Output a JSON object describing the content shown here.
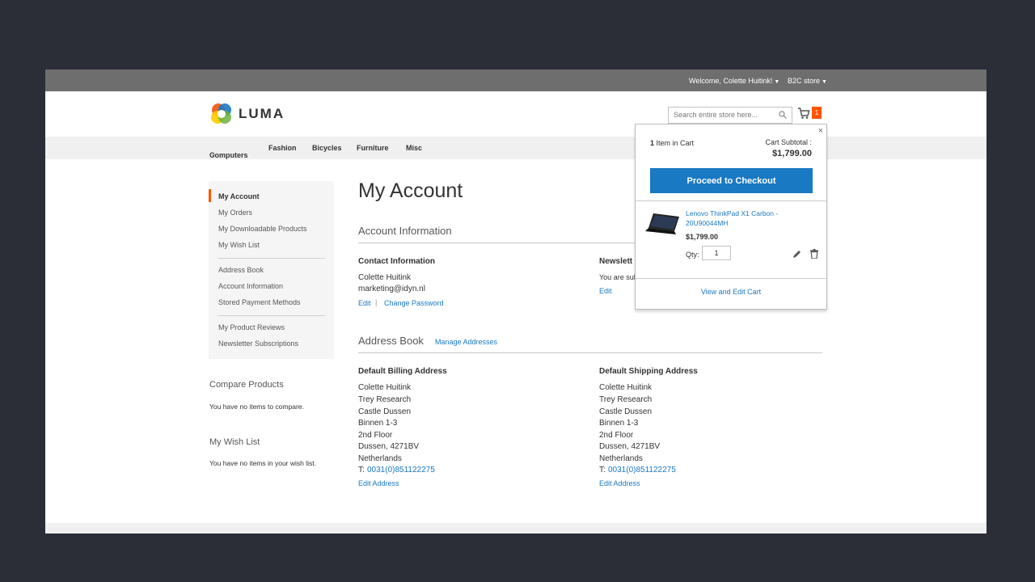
{
  "topbar": {
    "welcome": "Welcome, Colette Huitink!",
    "store": "B2C store"
  },
  "header": {
    "logo_text": "LUMA",
    "search_placeholder": "Search entire store here...",
    "cart_count": "1"
  },
  "nav": {
    "items": [
      "Computers",
      "Fashion",
      "Bicycles",
      "Furniture",
      "Misc"
    ]
  },
  "sidebar": {
    "items": [
      "My Account",
      "My Orders",
      "My Downloadable Products",
      "My Wish List",
      "Address Book",
      "Account Information",
      "Stored Payment Methods",
      "My Product Reviews",
      "Newsletter Subscriptions"
    ]
  },
  "compare": {
    "title": "Compare Products",
    "text": "You have no items to compare."
  },
  "wishlist": {
    "title": "My Wish List",
    "text": "You have no items in your wish list."
  },
  "main": {
    "title": "My Account",
    "account_info": {
      "title": "Account Information",
      "contact_title": "Contact Information",
      "name": "Colette Huitink",
      "email": "marketing@idyn.nl",
      "edit": "Edit",
      "separator": "|",
      "change_password": "Change Password",
      "newsletter_title": "Newslett",
      "newsletter_text": "You are sub",
      "newsletter_edit": "Edit"
    },
    "address_book": {
      "title": "Address Book",
      "manage": "Manage Addresses",
      "billing_title": "Default Billing Address",
      "shipping_title": "Default Shipping Address",
      "lines": [
        "Colette Huitink",
        "Trey Research",
        "Castle Dussen",
        "Binnen 1-3",
        "2nd Floor",
        "Dussen, 4271BV",
        "Netherlands"
      ],
      "phone_prefix": "T:",
      "phone": "0031(0)851122275",
      "edit_address": "Edit Address"
    }
  },
  "minicart": {
    "close": "×",
    "item_count": "1",
    "items_label": "Item in Cart",
    "subtotal_label": "Cart Subtotal :",
    "subtotal": "$1,799.00",
    "checkout": "Proceed to Checkout",
    "product_name": "Lenovo ThinkPad X1 Carbon - 20U90044MH",
    "product_price": "$1,799.00",
    "qty_label": "Qty:",
    "qty": "1",
    "view_cart": "View and Edit Cart"
  },
  "colors": {
    "accent": "#1979c3",
    "badge": "#ff5501",
    "topbar": "#6e6e6e",
    "backdrop": "#2b2e37"
  }
}
